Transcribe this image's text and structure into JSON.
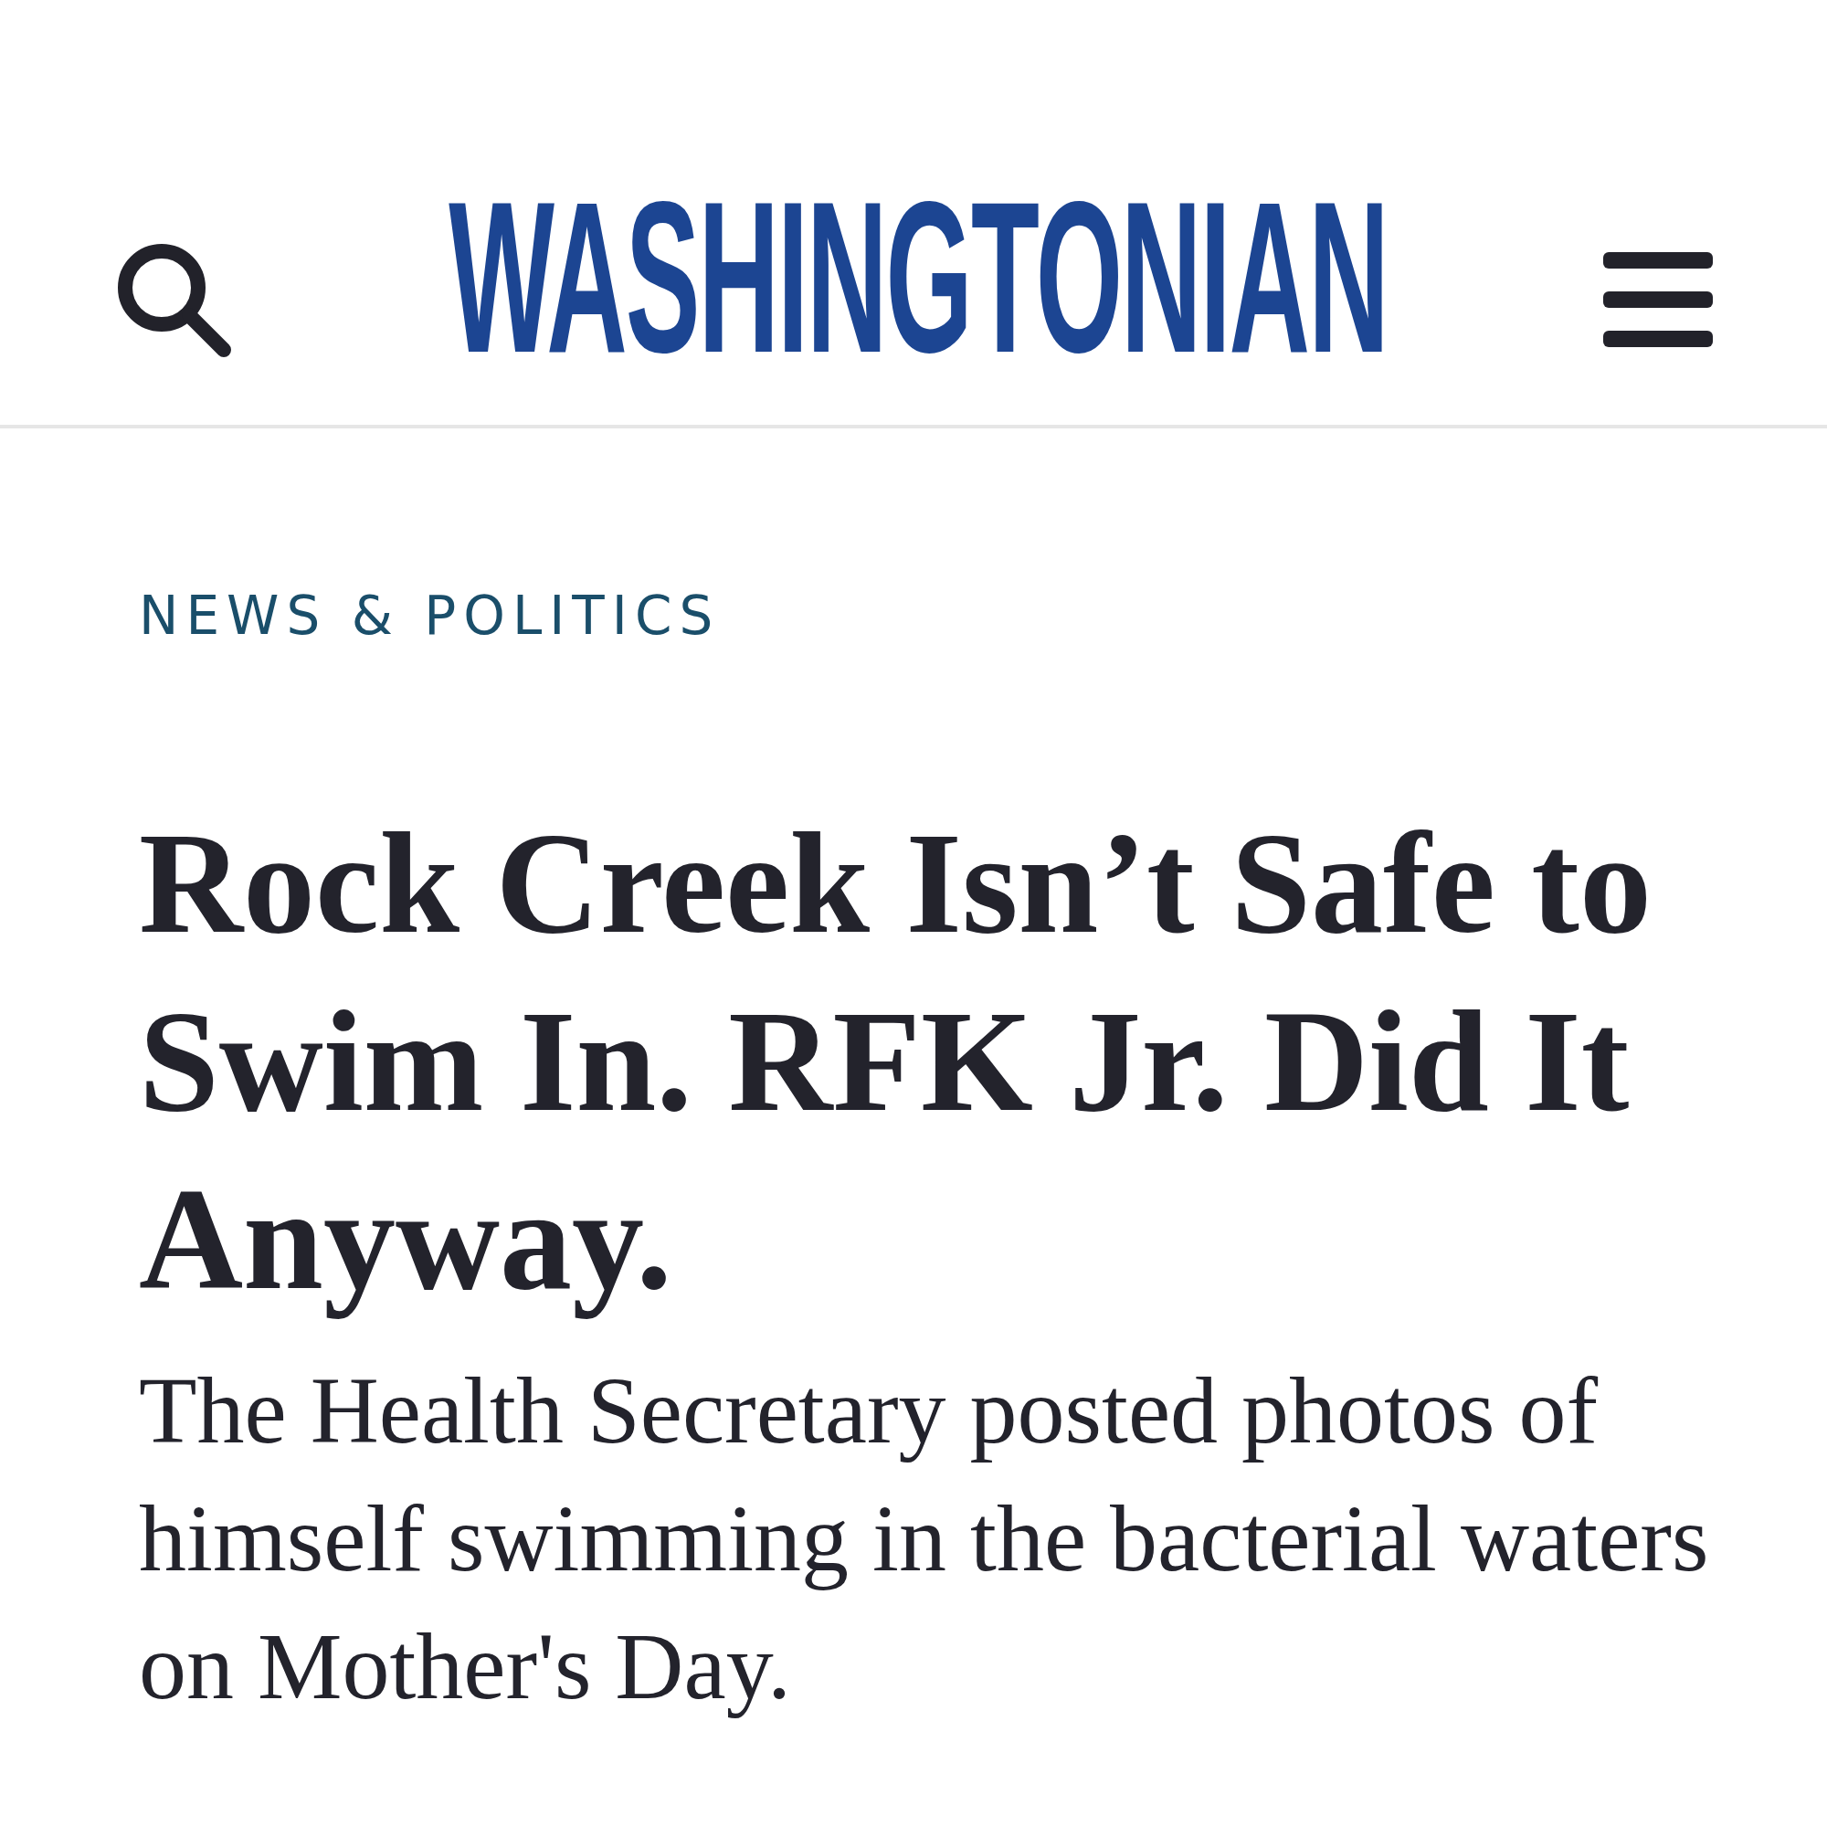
{
  "header": {
    "logo": "WASHINGTONIAN"
  },
  "article": {
    "category": "NEWS & POLITICS",
    "headline": "Rock Creek Isn’t Safe to Swim In. RFK Jr. Did It Anyway.",
    "dek": "The Health Secretary posted photos of himself swimming in the bacterial waters on Mother's Day."
  }
}
